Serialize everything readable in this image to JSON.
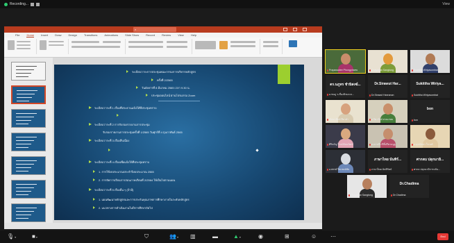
{
  "recording": {
    "label": "Recording..."
  },
  "view": {
    "label": "View"
  },
  "powerpoint": {
    "menu": [
      "File",
      "Home",
      "Insert",
      "Draw",
      "Design",
      "Transitions",
      "Animations",
      "Slide Show",
      "Record",
      "Review",
      "View",
      "Help"
    ],
    "active_menu": "Home"
  },
  "slide": {
    "lines": [
      {
        "text": "ระเบียบวาระการประชุมคณะกรรมการบริหารหลักสูตร",
        "kind": "title",
        "bullet": true
      },
      {
        "text": "ครั้งที่ 2/2565",
        "kind": "title",
        "bullet": true
      },
      {
        "text": "วันอังคารที่ 8 มีนาคม 2565 เวลา 9.30 น.",
        "kind": "title",
        "bullet": true
      },
      {
        "text": "ประชุมออนไลน์ ผ่านโปรแกรม Zoom",
        "kind": "title",
        "bullet": true
      },
      {
        "text": "ระเบียบวาระที่ 1 เรื่องที่ประธานแจ้งให้ที่ประชุมทราบ",
        "kind": "item",
        "bullet": true
      },
      {
        "text": "",
        "kind": "sub",
        "bullet": true
      },
      {
        "text": "ระเบียบวาระที่ 2 การรับรองรายงานการประชุม",
        "kind": "item",
        "bullet": true
      },
      {
        "text": "รับรองรายงานการประชุมครั้งที่ 1/2565 วันศุกร์ที่ 4 กุมภาพันธ์ 2565",
        "kind": "indent",
        "bullet": false
      },
      {
        "text": "ระเบียบวาระที่ 3 เรื่องสืบเนื่อง",
        "kind": "item",
        "bullet": true
      },
      {
        "text": "",
        "kind": "sub",
        "bullet": true
      },
      {
        "text": "ระเบียบวาระที่ 4 เรื่องเพื่อแจ้งให้ที่ประชุมทราบ",
        "kind": "item",
        "bullet": true
      },
      {
        "text": "1. การใช้งบประมาณประจำปีงบประมาณ 2565",
        "kind": "sub",
        "bullet": true
      },
      {
        "text": "2. การจัดการเรียนการสอนภาคเรียนที่ 2/2564 ให้เป็นไปตามแผน",
        "kind": "sub",
        "bullet": true
      },
      {
        "text": "ระเบียบวาระที่ 5 เรื่องอื่น ๆ (ถ้ามี)",
        "kind": "item",
        "bullet": true
      },
      {
        "text": "1. แผนพัฒนาหลักสูตรและการประกันคุณภาพการศึกษาภายในระดับหลักสูตร",
        "kind": "sub",
        "bullet": true
      },
      {
        "text": "2. แนวทางการดำเนินงานในปีการศึกษาถัดไป",
        "kind": "sub",
        "bullet": true
      }
    ]
  },
  "participants": [
    {
      "name": "Prapawadee Phongphaew",
      "big": "",
      "video": true,
      "active": true,
      "muted": true,
      "bg": "#4a6a3a",
      "skin": "#c98d6b",
      "shirt": "#a8336a"
    },
    {
      "name": "Chayanan Sangtong",
      "big": "",
      "video": true,
      "active": false,
      "muted": true,
      "bg": "#e8e1d2",
      "skin": "#e39a3c",
      "shirt": "#7d9c3a"
    },
    {
      "name": "Sukittha Wiriyasombat",
      "big": "",
      "video": true,
      "active": false,
      "muted": true,
      "bg": "#dcdcdc",
      "skin": "#b07a55",
      "shirt": "#31406b"
    },
    {
      "name": "อ.ชนภู ร.เรื่องนิรมล ค...",
      "big": "ดร.นภูทร ชำนิสงฆ์...",
      "video": false,
      "active": false,
      "muted": true
    },
    {
      "name": "Dr.Sirawut Hanranon",
      "big": "Dr.Sirawut Har...",
      "video": false,
      "active": false,
      "muted": true
    },
    {
      "name": "Sukittha Wiriyasombat",
      "big": "Sukittha Wiriya...",
      "video": false,
      "active": false,
      "muted": true
    },
    {
      "name": "เลิศมาทิพย์ สีดาคำ",
      "big": "",
      "video": true,
      "active": false,
      "muted": true,
      "bg": "#e9e2cf",
      "skin": "#d7a27e",
      "shirt": "#d8cbb0"
    },
    {
      "name": "อ.ปิยารัตน์ สวนเกษม",
      "big": "",
      "video": true,
      "active": false,
      "muted": true,
      "bg": "#d6d0bd",
      "skin": "#c98f6a",
      "shirt": "#477e3c"
    },
    {
      "name": "bon",
      "big": "bon",
      "video": false,
      "active": false,
      "muted": true
    },
    {
      "name": "ศิริขวัญ โรจน์รัตนวัฒน์",
      "big": "",
      "video": true,
      "active": false,
      "muted": true,
      "bg": "#3b3b4a",
      "skin": "#d9a97f",
      "shirt": "#e2a4b4"
    },
    {
      "name": "อ.ดารณี กรีติ์ปรีชามนูฐ",
      "big": "",
      "video": true,
      "active": false,
      "muted": true,
      "bg": "#c9c2b2",
      "skin": "#c58e6d",
      "shirt": "#b84f6a"
    },
    {
      "name": "อ.มุขนัชชา ใจวงศ์",
      "big": "",
      "video": true,
      "active": false,
      "muted": true,
      "bg": "#e7d6b4",
      "skin": "#8a5a3c",
      "shirt": "#e0c8a0"
    },
    {
      "name": "อ.พรรษ์ ปิยะพงษ์ชัย",
      "big": "",
      "video": true,
      "active": false,
      "muted": true,
      "bg": "#2c2f36",
      "skin": "#d8dce2",
      "shirt": "#6c88b8"
    },
    {
      "name": "ภาษาไทย นันทิรัตน์",
      "big": "ภาษาไทย นันทิร์...",
      "video": false,
      "active": false,
      "muted": true
    },
    {
      "name": "ศากล ปลุกนามิการะตับ...",
      "big": "ศากลบ ปลุกนามิ...",
      "video": false,
      "active": false,
      "muted": true
    },
    {
      "name": "Chayanan Sangtong",
      "big": "",
      "video": true,
      "active": false,
      "muted": true,
      "bg": "#e6e6e6",
      "skin": "#b7805e",
      "shirt": "#2c2c2c"
    },
    {
      "name": "Dr.Chadima",
      "big": "Dr.Chadima",
      "video": false,
      "active": false,
      "muted": true
    }
  ],
  "toolbar": {
    "items": [
      {
        "icon": "microphone-icon",
        "glyph": "🎙",
        "green": false
      },
      {
        "icon": "video-camera-icon",
        "glyph": "■",
        "green": false
      },
      {
        "icon": "security-icon",
        "glyph": "⛉",
        "green": false
      },
      {
        "icon": "participants-icon",
        "glyph": "👥",
        "green": false
      },
      {
        "icon": "polls-icon",
        "glyph": "▥",
        "green": false
      },
      {
        "icon": "chat-icon",
        "glyph": "▬",
        "green": false
      },
      {
        "icon": "share-screen-icon",
        "glyph": "▲",
        "green": true
      },
      {
        "icon": "record-icon",
        "glyph": "◉",
        "green": false
      },
      {
        "icon": "breakout-rooms-icon",
        "glyph": "⊞",
        "green": false
      },
      {
        "icon": "reactions-icon",
        "glyph": "☺",
        "green": false
      },
      {
        "icon": "more-icon",
        "glyph": "⋯",
        "green": false
      }
    ],
    "end_label": "End"
  }
}
